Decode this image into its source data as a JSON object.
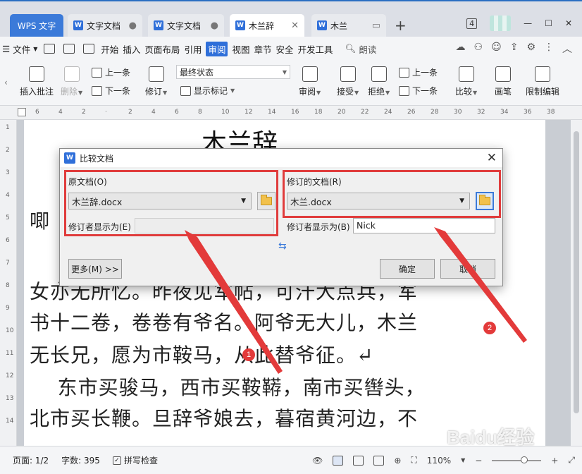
{
  "tabs": {
    "app": "WPS 文字",
    "items": [
      {
        "label": "文字文档"
      },
      {
        "label": "文字文档"
      },
      {
        "label": "木兰辞"
      },
      {
        "label": "木兰"
      }
    ],
    "new_tab": "+"
  },
  "window": {
    "badge": "4"
  },
  "menubar": {
    "file": "文件",
    "items": [
      "开始",
      "插入",
      "页面布局",
      "引用"
    ],
    "active": "审阅",
    "items_after": [
      "视图",
      "章节",
      "安全",
      "开发工具"
    ],
    "search": "朗读"
  },
  "ribbon": {
    "insert_comment": "插入批注",
    "delete": "删除",
    "prev_comment": "上一条",
    "next_comment": "下一条",
    "revise": "修订",
    "final_state": "最终状态",
    "show_markup": "显示标记",
    "review": "审阅",
    "accept": "接受",
    "reject": "拒绝",
    "prev_change": "上一条",
    "next_change": "下一条",
    "compare": "比较",
    "pen": "画笔",
    "restrict_edit": "限制编辑"
  },
  "ruler": {
    "h_ticks": [
      "6",
      "4",
      "2",
      "",
      "2",
      "4",
      "6",
      "8",
      "10",
      "12",
      "14",
      "16",
      "18",
      "20",
      "22",
      "24",
      "26",
      "28",
      "30",
      "32",
      "34",
      "36",
      "38"
    ],
    "v_ticks": [
      "1",
      "2",
      "3",
      "4",
      "5",
      "6",
      "7",
      "8",
      "9",
      "10",
      "11",
      "12",
      "13",
      "14"
    ]
  },
  "document": {
    "title": "木兰辞",
    "lines": [
      "唧",
      "女亦无所忆。昨夜见军帖，可汗大点兵，军",
      "书十二卷，卷卷有爷名。阿爷无大儿，木兰",
      "无长兄，愿为市鞍马，从此替爷征。↵",
      "    东市买骏马，西市买鞍鞯，南市买辔头，",
      "北市买长鞭。旦辞爷娘去，暮宿黄河边，不"
    ]
  },
  "dialog": {
    "title": "比较文档",
    "original_label": "原文档(O)",
    "original_file": "木兰辞.docx",
    "original_reviewer_label": "修订者显示为(E)",
    "original_reviewer_value": "",
    "revised_label": "修订的文档(R)",
    "revised_file": "木兰.docx",
    "revised_reviewer_label": "修订者显示为(B)",
    "revised_reviewer_value": "Nick",
    "more_button": "更多(M) >>",
    "ok_button": "确定",
    "cancel_button": "取消"
  },
  "statusbar": {
    "page": "页面: 1/2",
    "words": "字数: 395",
    "spellcheck": "拼写检查",
    "zoom": "110%"
  },
  "annotations": {
    "marker1": "1",
    "marker2": "2",
    "highlight_color": "#e03c3c"
  },
  "watermark": "Baidu经验"
}
